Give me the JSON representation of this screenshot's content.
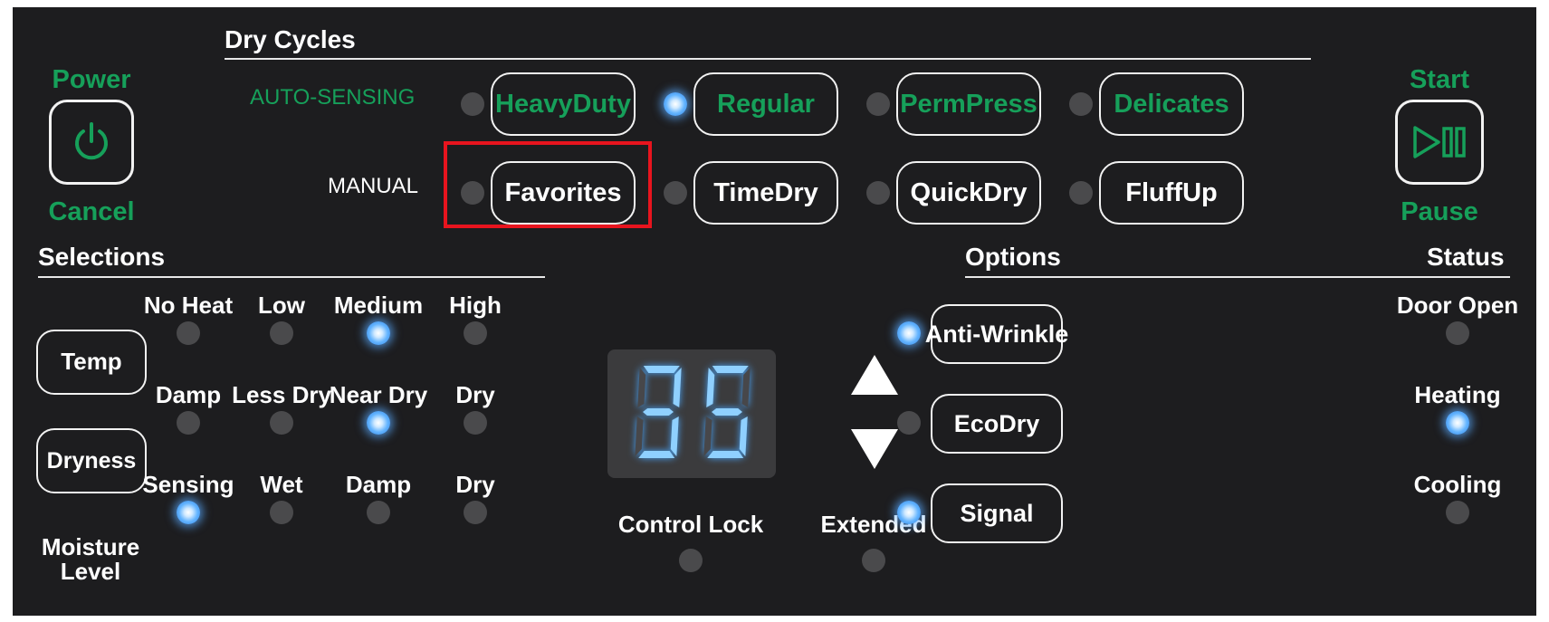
{
  "dry_cycles": {
    "header": "Dry Cycles",
    "auto_sensing_label": "AUTO-SENSING",
    "manual_label": "MANUAL",
    "auto_buttons": [
      {
        "lines": [
          "Heavy",
          "Duty"
        ],
        "lit": false
      },
      {
        "lines": [
          "Regular"
        ],
        "lit": true
      },
      {
        "lines": [
          "Perm",
          "Press"
        ],
        "lit": false
      },
      {
        "lines": [
          "Delicates"
        ],
        "lit": false
      }
    ],
    "manual_buttons": [
      {
        "lines": [
          "Favorites"
        ],
        "lit": false,
        "highlighted": true
      },
      {
        "lines": [
          "Time",
          "Dry"
        ],
        "lit": false
      },
      {
        "lines": [
          "Quick",
          "Dry"
        ],
        "lit": false
      },
      {
        "lines": [
          "Fluff",
          "Up"
        ],
        "lit": false
      }
    ]
  },
  "power": {
    "top_label": "Power",
    "bottom_label": "Cancel",
    "icon": "power-icon"
  },
  "start": {
    "top_label": "Start",
    "bottom_label": "Pause",
    "icon": "play-pause-icon"
  },
  "selections": {
    "header": "Selections",
    "temp": {
      "button": "Temp",
      "levels": [
        "No Heat",
        "Low",
        "Medium",
        "High"
      ],
      "active_index": 2
    },
    "dryness": {
      "button": "Dryness",
      "levels": [
        "Damp",
        "Less Dry",
        "Near Dry",
        "Dry"
      ],
      "active_index": 2
    },
    "moisture": {
      "label_lines": [
        "Moisture",
        "Level"
      ],
      "levels": [
        "Sensing",
        "Wet",
        "Damp",
        "Dry"
      ],
      "active_index": 0
    }
  },
  "display": {
    "value": "35"
  },
  "control_lock": {
    "label": "Control Lock",
    "lit": false
  },
  "extended": {
    "label": "Extended",
    "lit": false
  },
  "arrows": {
    "up": "up-arrow-icon",
    "down": "down-arrow-icon"
  },
  "options": {
    "header": "Options",
    "buttons": [
      {
        "lines": [
          "Anti-",
          "Wrinkle"
        ],
        "lit": true
      },
      {
        "lines": [
          "EcoDry"
        ],
        "lit": false
      },
      {
        "lines": [
          "Signal"
        ],
        "lit": true
      }
    ]
  },
  "status": {
    "header": "Status",
    "items": [
      {
        "label": "Door Open",
        "lit": false
      },
      {
        "label": "Heating",
        "lit": true
      },
      {
        "label": "Cooling",
        "lit": false
      }
    ]
  },
  "colors": {
    "panel": "#1d1d1f",
    "accent_green": "#16a05a",
    "led_on": "#63b4ff",
    "led_off": "#4a4a4c",
    "highlight_box": "#e8141e",
    "digits": "#8fd0ff"
  }
}
